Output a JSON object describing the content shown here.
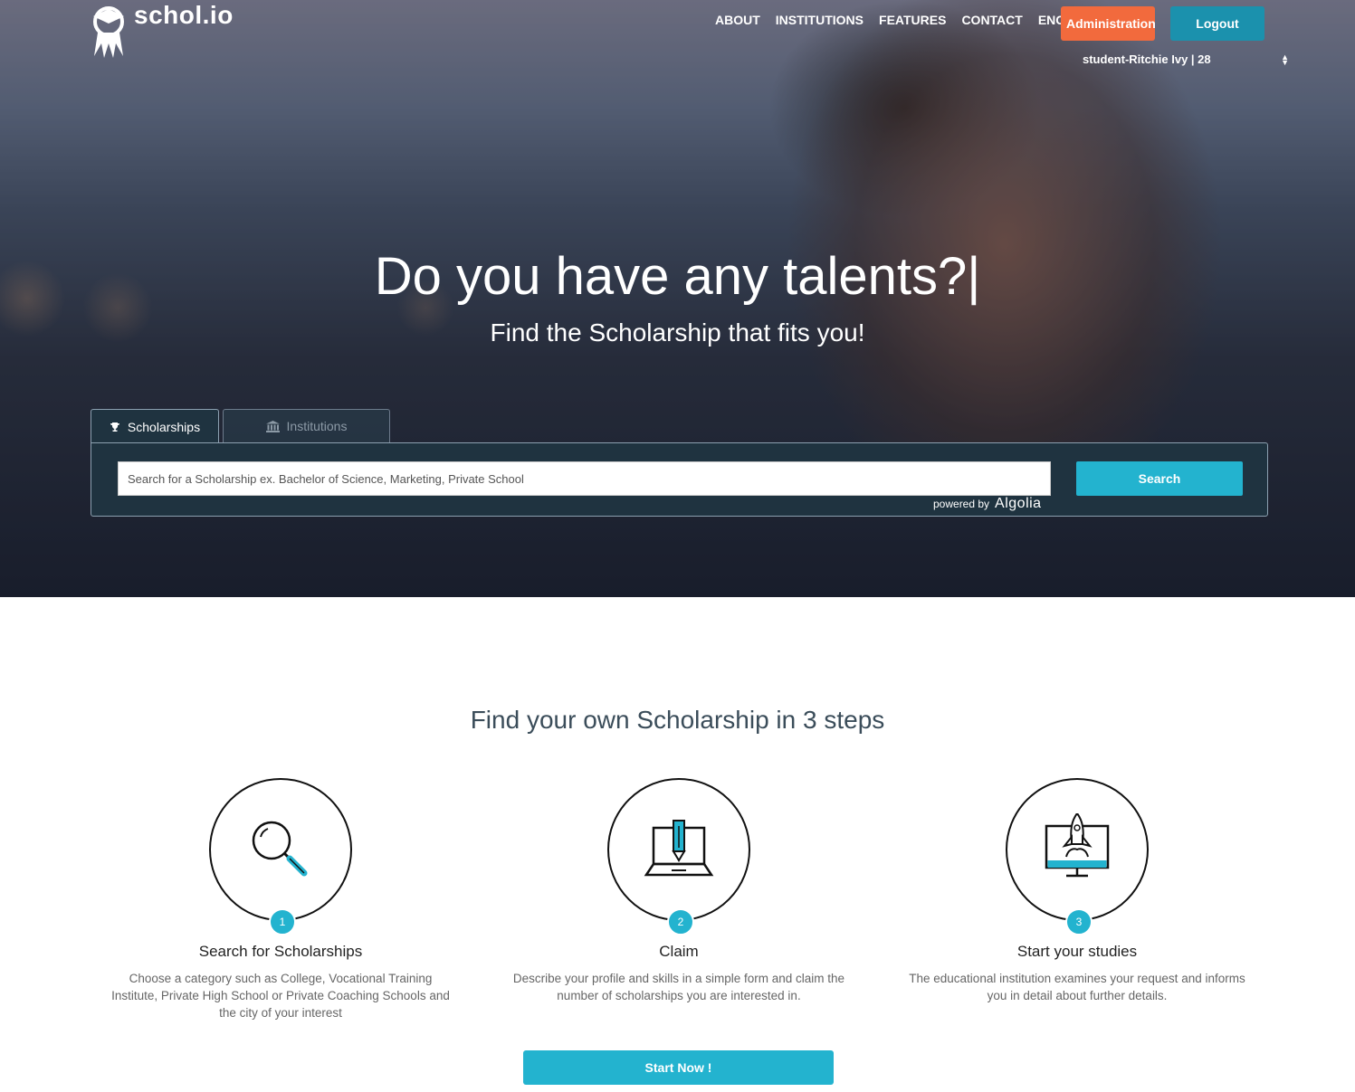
{
  "brand": {
    "name": "schol.io",
    "logo_icon": "graduate-mascot-icon"
  },
  "nav": {
    "items": [
      "ABOUT",
      "INSTITUTIONS",
      "FEATURES",
      "CONTACT"
    ],
    "language": "ENG",
    "admin_label": "Administration",
    "logout_label": "Logout",
    "user_select": "student-Ritchie Ivy | 28"
  },
  "hero": {
    "headline": "Do you have any talents?|",
    "subline": "Find the Scholarship that fits you!"
  },
  "search": {
    "tabs": [
      {
        "label": "Scholarships",
        "icon": "trophy-icon"
      },
      {
        "label": "Institutions",
        "icon": "institution-icon"
      }
    ],
    "placeholder": "Search for a Scholarship ex. Bachelor of Science, Marketing, Private School",
    "powered_by": "powered by",
    "provider": "Algolia",
    "button_label": "Search"
  },
  "steps": {
    "title": "Find your own Scholarship in 3 steps",
    "items": [
      {
        "number": "1",
        "icon": "magnifier-icon",
        "title": "Search for Scholarships",
        "desc": "Choose a category such as College, Vocational Training Institute, Private High School or Private Coaching Schools and the city of your interest"
      },
      {
        "number": "2",
        "icon": "laptop-pencil-icon",
        "title": "Claim",
        "desc": "Describe your profile and skills in a simple form and claim the number of scholarships you are interested in."
      },
      {
        "number": "3",
        "icon": "monitor-rocket-icon",
        "title": "Start your studies",
        "desc": "The educational institution examines your request and informs you in detail about further details."
      }
    ],
    "cta_label": "Start Now !"
  },
  "colors": {
    "accent": "#23b3cf",
    "admin": "#f26a3d",
    "logout": "#1b91ad",
    "panel": "#1f3340"
  }
}
